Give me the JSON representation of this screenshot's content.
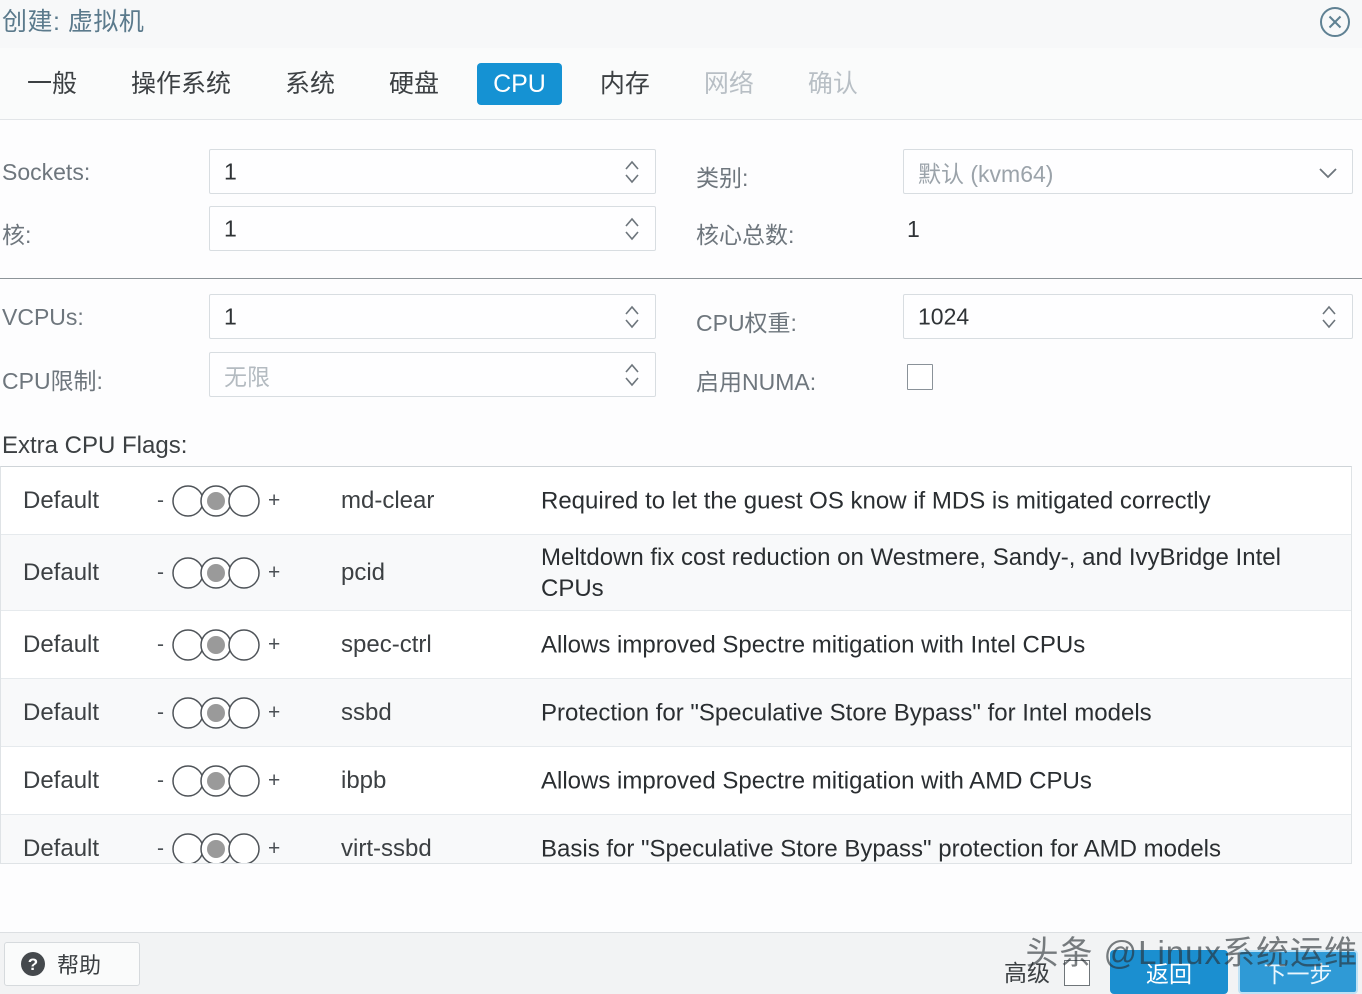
{
  "window": {
    "title": "创建: 虚拟机",
    "close_icon": "close-circle-icon"
  },
  "tabs": [
    {
      "label": "一般",
      "state": "normal"
    },
    {
      "label": "操作系统",
      "state": "normal"
    },
    {
      "label": "系统",
      "state": "normal"
    },
    {
      "label": "硬盘",
      "state": "normal"
    },
    {
      "label": "CPU",
      "state": "active"
    },
    {
      "label": "内存",
      "state": "normal"
    },
    {
      "label": "网络",
      "state": "disabled"
    },
    {
      "label": "确认",
      "state": "disabled"
    }
  ],
  "form": {
    "sockets": {
      "label": "Sockets:",
      "value": "1"
    },
    "cores": {
      "label": "核:",
      "value": "1"
    },
    "type": {
      "label": "类别:",
      "value": "默认 (kvm64)"
    },
    "total_cores": {
      "label": "核心总数:",
      "value": "1"
    },
    "vcpus": {
      "label": "VCPUs:",
      "value": "1"
    },
    "cpu_limit": {
      "label": "CPU限制:",
      "placeholder": "无限"
    },
    "cpu_units": {
      "label": "CPU权重:",
      "value": "1024"
    },
    "enable_numa": {
      "label": "启用NUMA:",
      "checked": false
    }
  },
  "flags": {
    "title": "Extra CPU Flags:",
    "state_label": "Default",
    "minus": "-",
    "plus": "+",
    "rows": [
      {
        "state": "Default",
        "name": "md-clear",
        "desc": "Required to let the guest OS know if MDS is mitigated correctly"
      },
      {
        "state": "Default",
        "name": "pcid",
        "desc": "Meltdown fix cost reduction on Westmere, Sandy-, and IvyBridge Intel CPUs"
      },
      {
        "state": "Default",
        "name": "spec-ctrl",
        "desc": "Allows improved Spectre mitigation with Intel CPUs"
      },
      {
        "state": "Default",
        "name": "ssbd",
        "desc": "Protection for \"Speculative Store Bypass\" for Intel models"
      },
      {
        "state": "Default",
        "name": "ibpb",
        "desc": "Allows improved Spectre mitigation with AMD CPUs"
      },
      {
        "state": "Default",
        "name": "virt-ssbd",
        "desc": "Basis for \"Speculative Store Bypass\" protection for AMD models"
      }
    ]
  },
  "footer": {
    "help_label": "帮助",
    "help_icon": "question-circle-icon",
    "advanced_label": "高级",
    "advanced_checked": false,
    "back_label": "返回",
    "next_label": "下一步"
  },
  "watermark": {
    "text": "头条 @Linux系统运维"
  },
  "colors": {
    "accent": "#1592d3",
    "accent_dark": "#1b8fd0",
    "title": "#5b7a8c",
    "text": "#3c4043",
    "muted": "#9ba3aa",
    "border": "#d8dde1"
  }
}
